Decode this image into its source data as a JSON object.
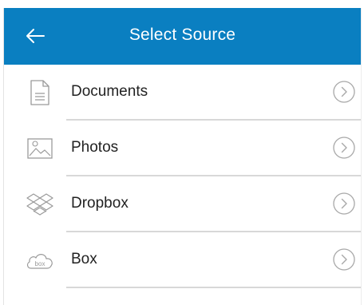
{
  "header": {
    "title": "Select Source",
    "background_color": "#0a7fc1",
    "back_icon": "arrow-left-icon"
  },
  "sources": [
    {
      "label": "Documents",
      "icon": "document-icon"
    },
    {
      "label": "Photos",
      "icon": "photo-icon"
    },
    {
      "label": "Dropbox",
      "icon": "dropbox-icon"
    },
    {
      "label": "Box",
      "icon": "box-cloud-icon",
      "icon_text": "box"
    }
  ],
  "row_action_icon": "chevron-right-circle-icon"
}
